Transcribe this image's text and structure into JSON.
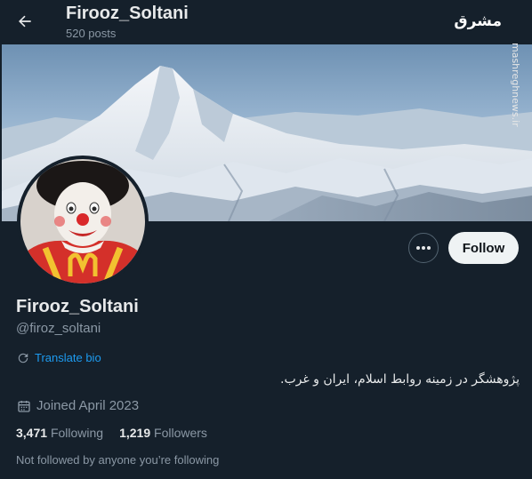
{
  "header": {
    "back_icon": "arrow-left-icon",
    "name": "Firooz_Soltani",
    "posts": "520 posts"
  },
  "watermark": {
    "persian": "مشرق",
    "english": "mashreghnews.ir"
  },
  "profile": {
    "display_name": "Firooz_Soltani",
    "handle": "@firoz_soltani",
    "translate_label": "Translate bio",
    "bio": "پژوهشگر در زمینه روابط اسلام، ایران و غرب.",
    "joined": "Joined April 2023",
    "following_count": "3,471",
    "following_label": "Following",
    "followers_count": "1,219",
    "followers_label": "Followers",
    "not_followed": "Not followed by anyone you’re following"
  },
  "actions": {
    "more_icon": "more-horizontal-icon",
    "follow_label": "Follow"
  },
  "colors": {
    "background": "#15202b",
    "accent": "#1d9bf0",
    "secondary_text": "#8b98a5",
    "primary_text": "#e7e9ea"
  }
}
